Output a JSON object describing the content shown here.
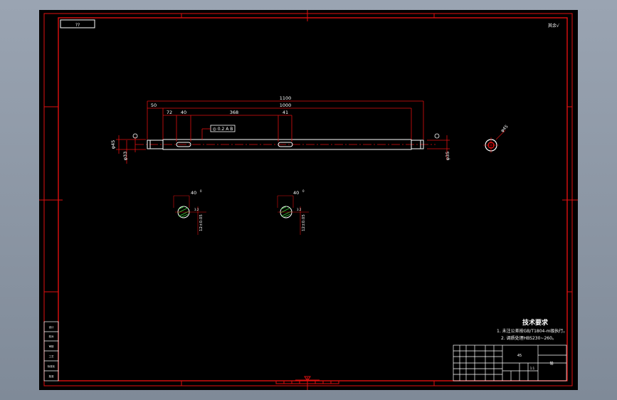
{
  "drawing": {
    "top_left_tag": "??",
    "top_right_mark": "其余√",
    "dims": {
      "overall": "1100",
      "main": "1000",
      "left_end": "50",
      "seg_72": "72",
      "seg_40": "40",
      "seg_368": "368",
      "seg_41": "41",
      "dia_45": "φ45",
      "dia_33": "φ33",
      "dia_35": "φ35",
      "dia_end": "φ45"
    },
    "tolerance_frame": "◎ 0.2 A B",
    "section_left": {
      "width": "40",
      "tol": "0\n-0.21",
      "depth": "12±0.05",
      "rough": "3.2"
    },
    "section_right": {
      "width": "40",
      "tol": "0\n-0.21",
      "depth": "12±0.05",
      "rough": "3.2"
    },
    "tech_title": "技术要求",
    "tech_lines": [
      "1. 未注公差按GB/T1804-m级执行。",
      "2. 调质处理HBS230~260。"
    ],
    "title_block": {
      "cell_a": "45",
      "cell_b": "轴",
      "cell_c": "1:1"
    },
    "left_strip": [
      "设计",
      "校对",
      "审核",
      "工艺",
      "标准化",
      "批准"
    ]
  }
}
